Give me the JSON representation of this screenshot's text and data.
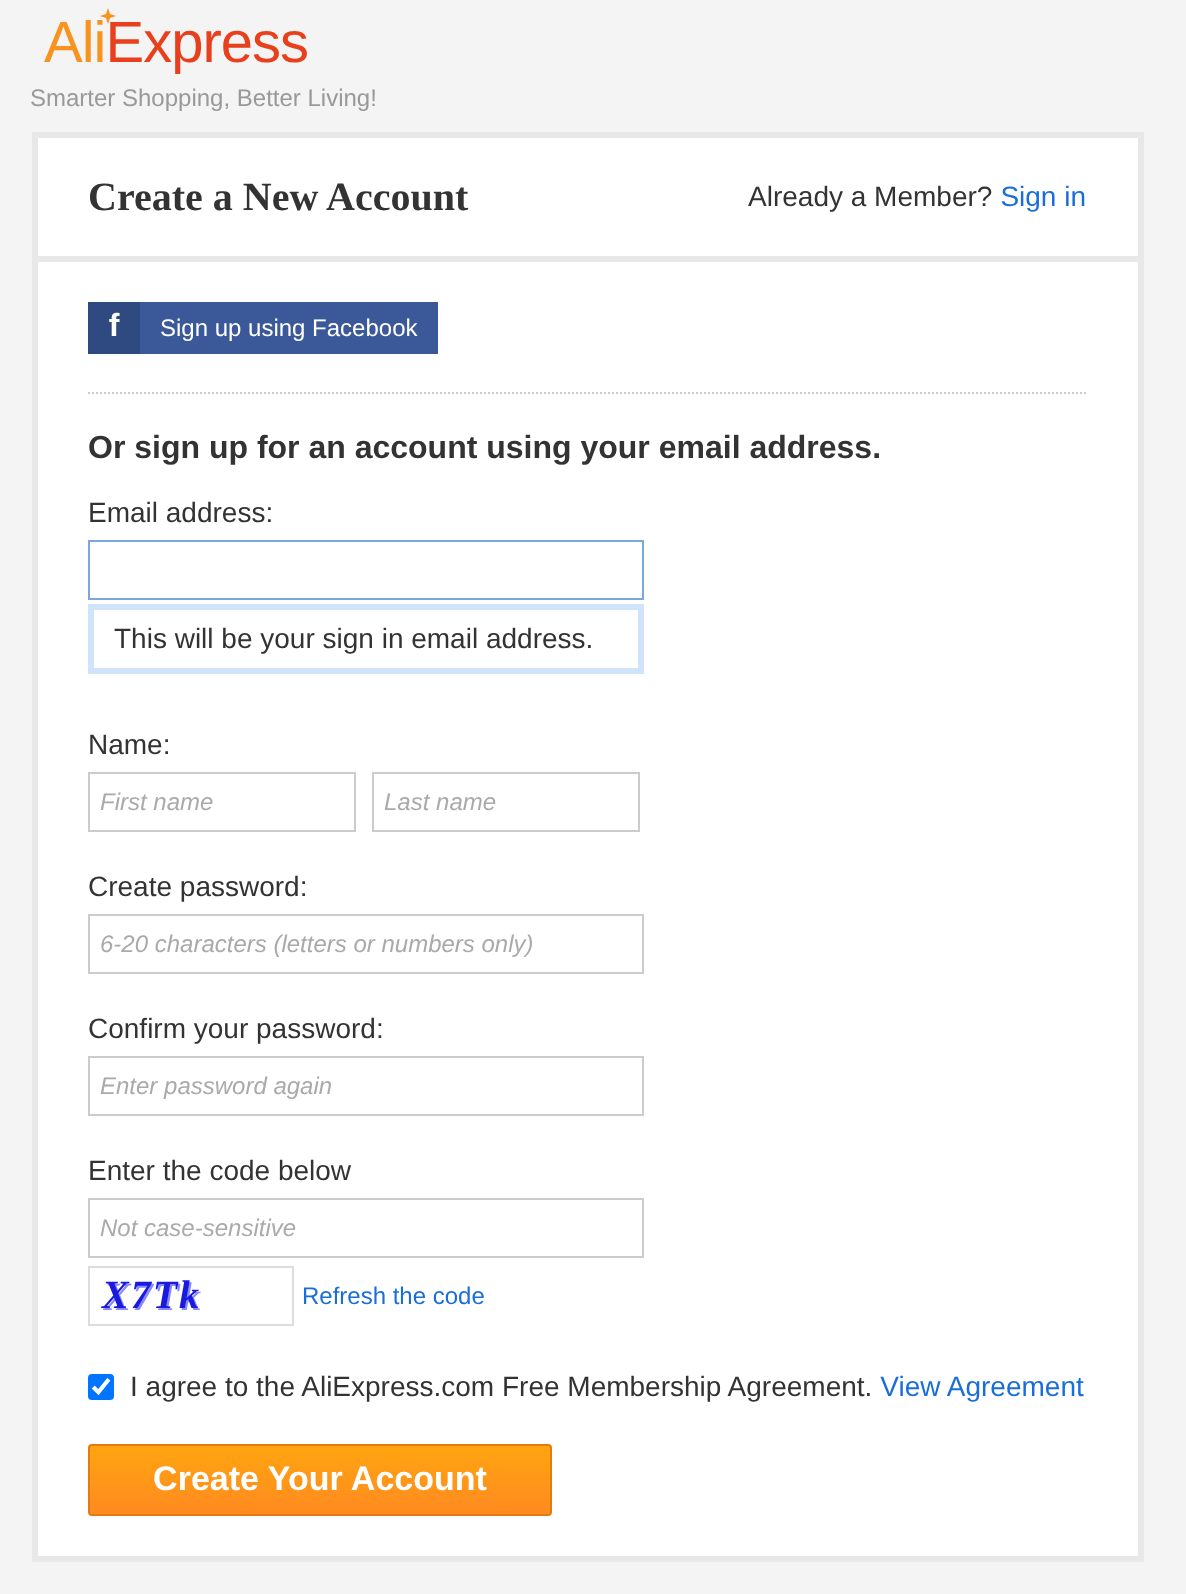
{
  "logo": {
    "first": "Ali",
    "second": "Express"
  },
  "tagline": "Smarter Shopping, Better Living!",
  "header": {
    "title": "Create a New Account",
    "member_text": "Already a Member?",
    "sign_in": "Sign in"
  },
  "facebook_button": {
    "icon": "f",
    "label": "Sign up using Facebook"
  },
  "section_title": "Or sign up for an account using your email address.",
  "fields": [
    {
      "kind": "single",
      "label": "Email address:",
      "hint": "This will be your sign in email address.",
      "inputs": [
        {
          "focused": true
        }
      ]
    },
    {
      "kind": "pair",
      "label": "Name:",
      "inputs": [
        {
          "placeholder": "First name",
          "focused": false
        },
        {
          "placeholder": "Last name",
          "focused": false
        }
      ]
    },
    {
      "kind": "single",
      "label": "Create password:",
      "inputs": [
        {
          "placeholder": "6-20 characters (letters or numbers only)",
          "focused": false
        }
      ]
    },
    {
      "kind": "single",
      "label": "Confirm your password:",
      "inputs": [
        {
          "placeholder": "Enter password again",
          "focused": false
        }
      ]
    },
    {
      "kind": "single",
      "label": "Enter the code below",
      "inputs": [
        {
          "placeholder": "Not case-sensitive",
          "focused": false
        }
      ]
    }
  ],
  "captcha": {
    "code": "X7Tk",
    "refresh": "Refresh the code"
  },
  "agreement": {
    "checked": true,
    "text": "I agree to the AliExpress.com Free Membership Agreement.",
    "link": "View Agreement"
  },
  "submit": "Create Your Account"
}
